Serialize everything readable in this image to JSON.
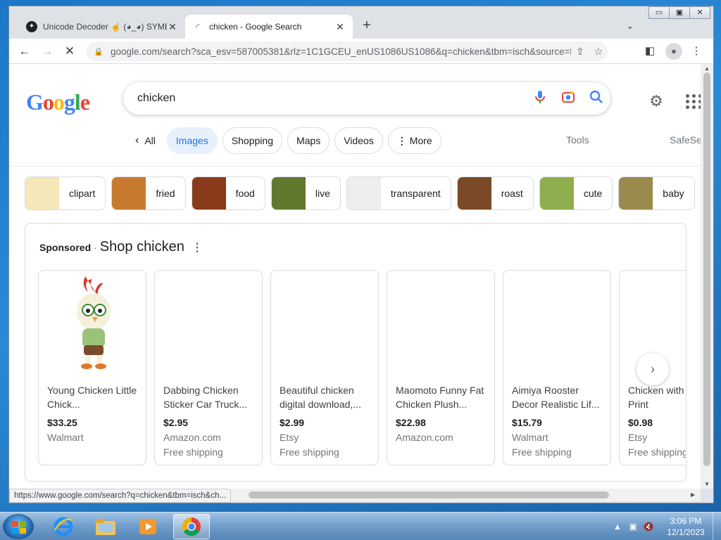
{
  "browser": {
    "tabs": [
      {
        "title": "Unicode Decoder ☝ (◕_◕) SYMBOLS",
        "favicon": "unicode-decoder-favicon",
        "active": false
      },
      {
        "title": "chicken - Google Search",
        "favicon": "loading-spinner",
        "active": true
      }
    ],
    "new_tab_label": "+",
    "url": "google.com/search?sca_esv=587005381&rlz=1C1GCEU_enUS1086US1086&q=chicken&tbm=isch&source=lnms&sa=X",
    "status_url": "https://www.google.com/search?q=chicken&tbm=isch&ch..."
  },
  "search": {
    "query": "chicken",
    "logo": "Google"
  },
  "filters": {
    "back_label": "All",
    "chips": [
      "Images",
      "Shopping",
      "Maps",
      "Videos",
      "More"
    ],
    "active": "Images",
    "tools_label": "Tools",
    "safesearch_label": "SafeSearch"
  },
  "related": [
    {
      "label": "clipart",
      "color": "#f6e7b8"
    },
    {
      "label": "fried",
      "color": "#c77a2d"
    },
    {
      "label": "food",
      "color": "#8a3b1c"
    },
    {
      "label": "live",
      "color": "#5f7a2e"
    },
    {
      "label": "transparent",
      "color": "#eeeeee"
    },
    {
      "label": "roast",
      "color": "#7a4a26"
    },
    {
      "label": "cute",
      "color": "#8fae4d"
    },
    {
      "label": "baby",
      "color": "#9a8a4e"
    }
  ],
  "shopping": {
    "sponsored_label": "Sponsored",
    "separator": "·",
    "title": "Shop chicken",
    "products": [
      {
        "name": "Young Chicken Little Chick...",
        "price": "$33.25",
        "store": "Walmart",
        "shipping": ""
      },
      {
        "name": "Dabbing Chicken Sticker Car Truck...",
        "price": "$2.95",
        "store": "Amazon.com",
        "shipping": "Free shipping"
      },
      {
        "name": "Beautiful chicken digital download,...",
        "price": "$2.99",
        "store": "Etsy",
        "shipping": "Free shipping"
      },
      {
        "name": "Maomoto Funny Fat Chicken Plush...",
        "price": "$22.98",
        "store": "Amazon.com",
        "shipping": ""
      },
      {
        "name": "Aimiya Rooster Decor Realistic Lif...",
        "price": "$15.79",
        "store": "Walmart",
        "shipping": "Free shipping"
      },
      {
        "name": "Chicken with | Digital Print",
        "price": "$0.98",
        "store": "Etsy",
        "shipping": "Free shipping"
      }
    ]
  },
  "taskbar": {
    "time": "3:06 PM",
    "date": "12/1/2023",
    "items": [
      "internet-explorer-icon",
      "file-explorer-icon",
      "media-player-icon",
      "chrome-icon"
    ]
  },
  "colors": {
    "accent": "#1a73e8",
    "active_chip_bg": "#e8f0fe"
  }
}
